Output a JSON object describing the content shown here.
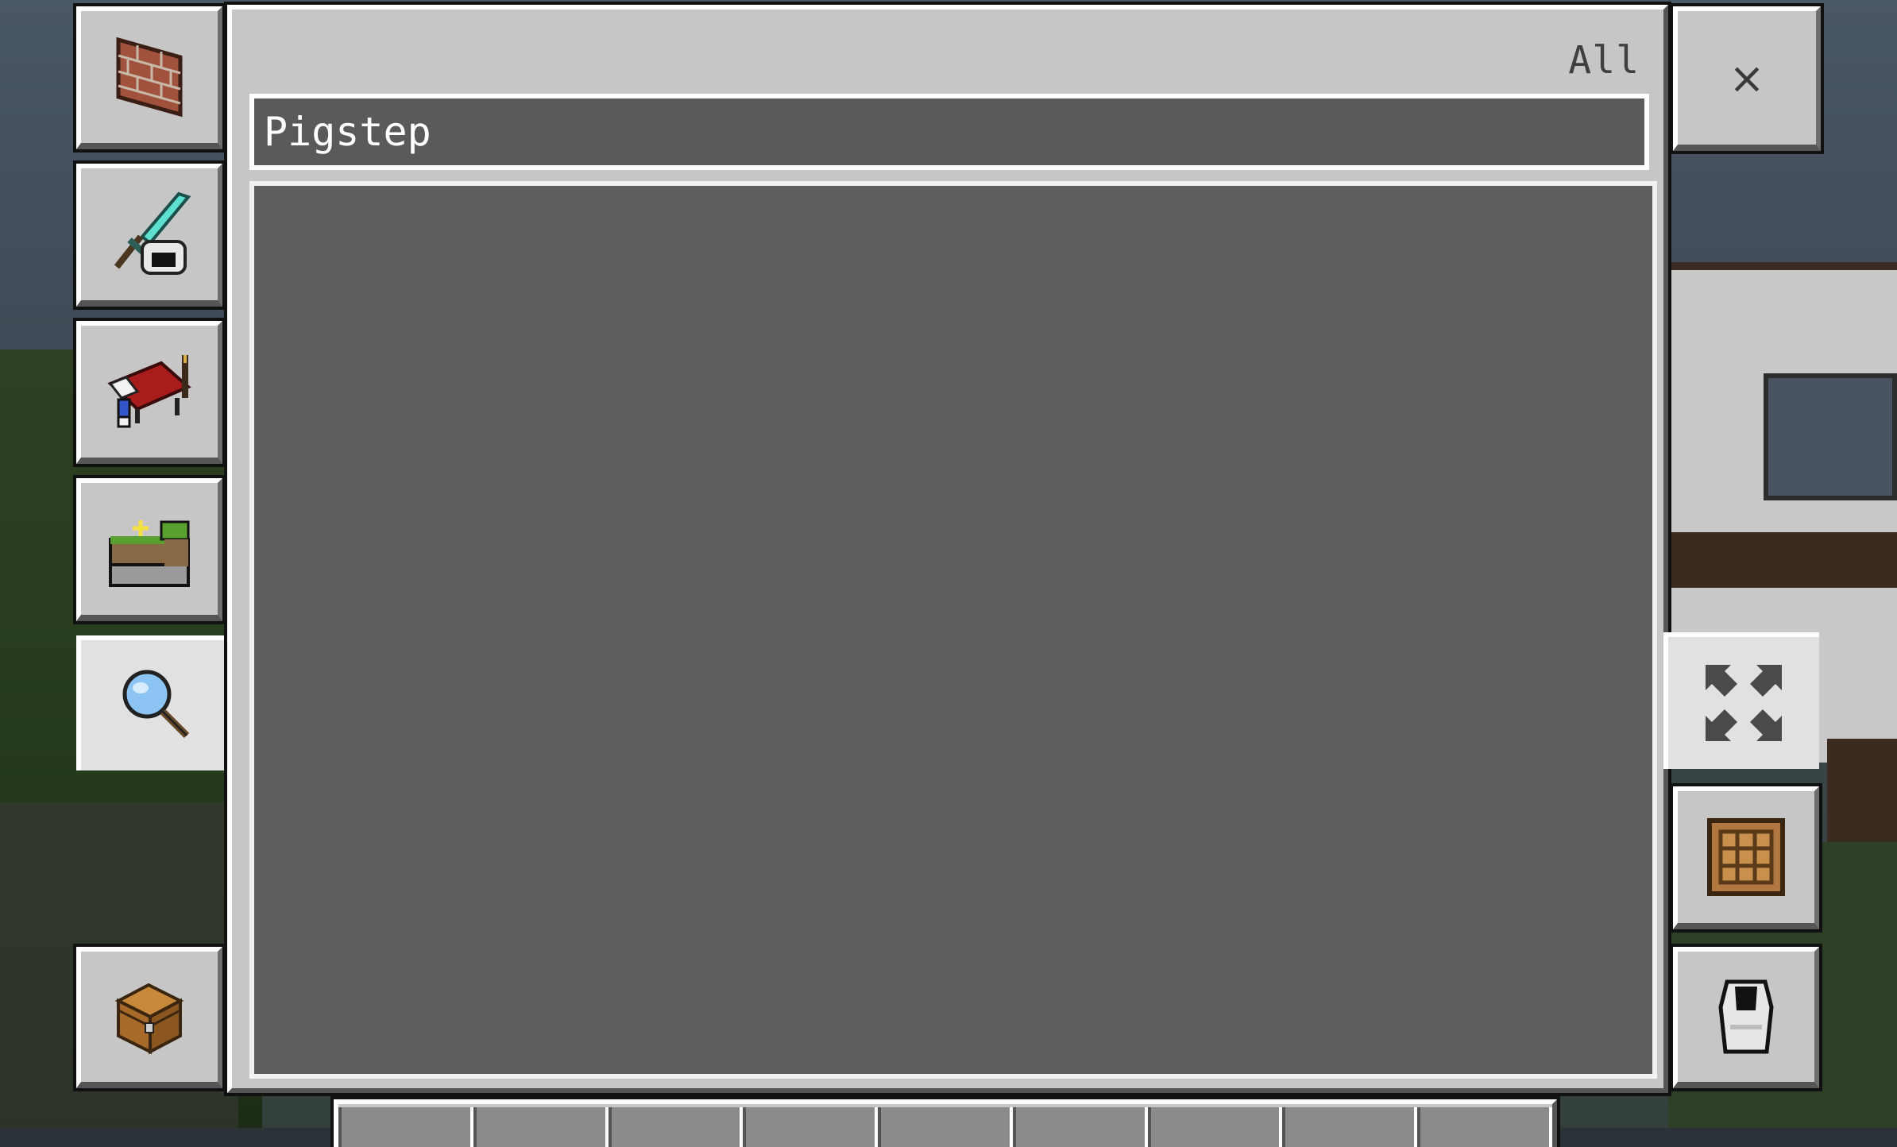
{
  "screen": {
    "filter_label": "All",
    "search": {
      "value": "Pigstep",
      "placeholder": ""
    },
    "close_label": "×"
  },
  "left_tabs": [
    {
      "name": "construction-tab",
      "icon": "brick-wall-icon"
    },
    {
      "name": "equipment-tab",
      "icon": "diamond-sword-helmet-icon"
    },
    {
      "name": "items-tab",
      "icon": "red-bed-icon"
    },
    {
      "name": "nature-tab",
      "icon": "grass-block-icon"
    },
    {
      "name": "search-tab",
      "icon": "magnifying-glass-icon",
      "selected": true
    },
    {
      "name": "inventory-tab",
      "icon": "chest-icon"
    }
  ],
  "right_tabs": [
    {
      "name": "close-button",
      "icon": "close-icon"
    },
    {
      "name": "fullscreen-button",
      "icon": "expand-arrows-icon"
    },
    {
      "name": "crafting-tab",
      "icon": "crafting-table-icon"
    },
    {
      "name": "armor-tab",
      "icon": "chestplate-icon"
    }
  ],
  "colors": {
    "panel": "#c6c6c6",
    "results_bg": "#5d5d5d",
    "search_bg": "#5a5a5a",
    "highlight": "#ffffff",
    "shadow": "#555555"
  },
  "hotbar": {
    "slots": 9
  }
}
